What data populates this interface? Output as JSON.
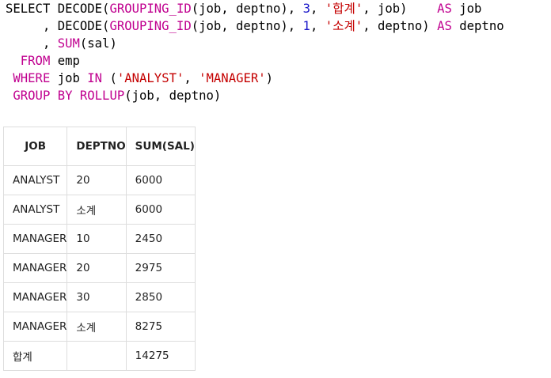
{
  "sql": {
    "lines": [
      [
        {
          "t": "SELECT",
          "c": "pl"
        },
        {
          "t": " DECODE(",
          "c": "pl"
        },
        {
          "t": "GROUPING_ID",
          "c": "kw"
        },
        {
          "t": "(job, deptno), ",
          "c": "pl"
        },
        {
          "t": "3",
          "c": "num"
        },
        {
          "t": ", ",
          "c": "pl"
        },
        {
          "t": "'합계'",
          "c": "str"
        },
        {
          "t": ", job)    ",
          "c": "pl"
        },
        {
          "t": "AS",
          "c": "kw"
        },
        {
          "t": " job",
          "c": "pl"
        }
      ],
      [
        {
          "t": "     , DECODE(",
          "c": "pl"
        },
        {
          "t": "GROUPING_ID",
          "c": "kw"
        },
        {
          "t": "(job, deptno), ",
          "c": "pl"
        },
        {
          "t": "1",
          "c": "num"
        },
        {
          "t": ", ",
          "c": "pl"
        },
        {
          "t": "'소계'",
          "c": "str"
        },
        {
          "t": ", deptno) ",
          "c": "pl"
        },
        {
          "t": "AS",
          "c": "kw"
        },
        {
          "t": " deptno",
          "c": "pl"
        }
      ],
      [
        {
          "t": "     , ",
          "c": "pl"
        },
        {
          "t": "SUM",
          "c": "kw"
        },
        {
          "t": "(sal)",
          "c": "pl"
        }
      ],
      [
        {
          "t": "  ",
          "c": "pl"
        },
        {
          "t": "FROM",
          "c": "kw"
        },
        {
          "t": " emp",
          "c": "pl"
        }
      ],
      [
        {
          "t": " ",
          "c": "pl"
        },
        {
          "t": "WHERE",
          "c": "kw"
        },
        {
          "t": " job ",
          "c": "pl"
        },
        {
          "t": "IN",
          "c": "kw"
        },
        {
          "t": " (",
          "c": "pl"
        },
        {
          "t": "'ANALYST'",
          "c": "str"
        },
        {
          "t": ", ",
          "c": "pl"
        },
        {
          "t": "'MANAGER'",
          "c": "str"
        },
        {
          "t": ")",
          "c": "pl"
        }
      ],
      [
        {
          "t": " ",
          "c": "pl"
        },
        {
          "t": "GROUP BY",
          "c": "kw"
        },
        {
          "t": " ",
          "c": "pl"
        },
        {
          "t": "ROLLUP",
          "c": "kw"
        },
        {
          "t": "(job, deptno)",
          "c": "pl"
        }
      ]
    ]
  },
  "result": {
    "headers": [
      "JOB",
      "DEPTNO",
      "SUM(SAL)"
    ],
    "rows": [
      [
        "ANALYST",
        "20",
        "6000"
      ],
      [
        "ANALYST",
        "소계",
        "6000"
      ],
      [
        "MANAGER",
        "10",
        "2450"
      ],
      [
        "MANAGER",
        "20",
        "2975"
      ],
      [
        "MANAGER",
        "30",
        "2850"
      ],
      [
        "MANAGER",
        "소계",
        "8275"
      ],
      [
        "합계",
        "",
        "14275"
      ]
    ]
  },
  "colors": {
    "keyword": "#c0008f",
    "number": "#1a17c9",
    "string": "#c40000",
    "border": "#dddddd"
  }
}
